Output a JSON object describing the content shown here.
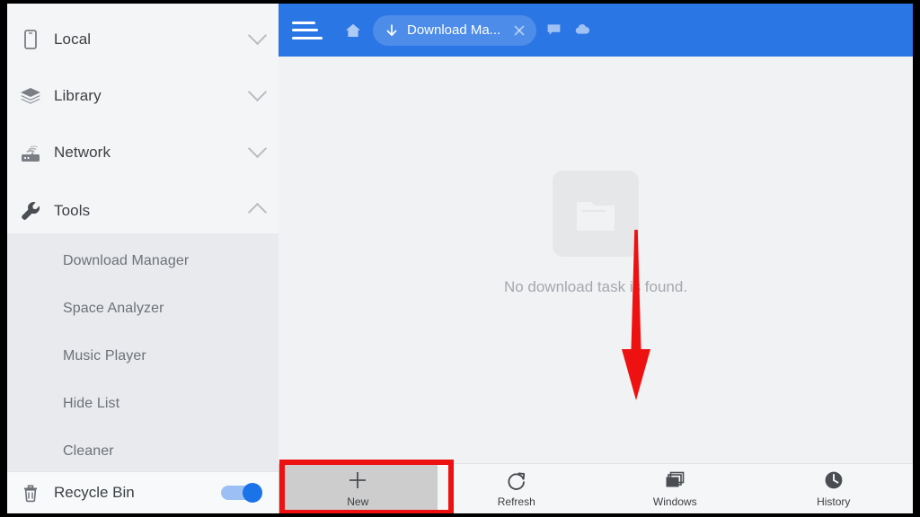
{
  "window": {
    "frame_color": "#000000",
    "accent_color": "#2b76e5"
  },
  "sidebar": {
    "items": [
      {
        "label": "Local",
        "icon": "phone-icon",
        "chevron": "chevron-down-icon",
        "expanded": false
      },
      {
        "label": "Library",
        "icon": "layers-icon",
        "chevron": "chevron-down-icon",
        "expanded": false
      },
      {
        "label": "Network",
        "icon": "router-icon",
        "chevron": "chevron-down-icon",
        "expanded": false
      },
      {
        "label": "Tools",
        "icon": "wrench-icon",
        "chevron": "chevron-up-icon",
        "expanded": true
      }
    ],
    "sub_items": [
      {
        "label": "Download Manager",
        "selected": true
      },
      {
        "label": "Space Analyzer",
        "selected": false
      },
      {
        "label": "Music Player",
        "selected": false
      },
      {
        "label": "Hide List",
        "selected": false
      },
      {
        "label": "Cleaner",
        "selected": false
      }
    ],
    "recycle_bin": {
      "label": "Recycle Bin",
      "icon": "trash-icon",
      "toggle": {
        "name": "recycle-bin-toggle",
        "state": "on",
        "color": "#1a73e8"
      }
    }
  },
  "topbar": {
    "menu_icon": "hamburger-menu-icon",
    "home_icon": "home-icon",
    "tab": {
      "icon": "download-arrow-icon",
      "title": "Download Ma...",
      "close_icon": "close-icon"
    },
    "extras": [
      {
        "icon": "message-icon",
        "name": "message-icon"
      },
      {
        "icon": "cloud-icon",
        "name": "cloud-icon"
      }
    ]
  },
  "main": {
    "empty_state": {
      "icon": "folder-icon",
      "message": "No download task is found."
    }
  },
  "bottombar": {
    "buttons": [
      {
        "label": "New",
        "icon": "plus-icon",
        "active": true
      },
      {
        "label": "Refresh",
        "icon": "refresh-icon",
        "active": false
      },
      {
        "label": "Windows",
        "icon": "windows-stack-icon",
        "active": false
      },
      {
        "label": "History",
        "icon": "clock-icon",
        "active": false
      }
    ]
  },
  "annotations": {
    "arrow": {
      "name": "red-down-arrow-annotation",
      "color": "#ee1111",
      "direction": "down"
    },
    "highlight": {
      "name": "red-highlight-box-annotation",
      "color": "#ee1111",
      "target": "New"
    }
  }
}
